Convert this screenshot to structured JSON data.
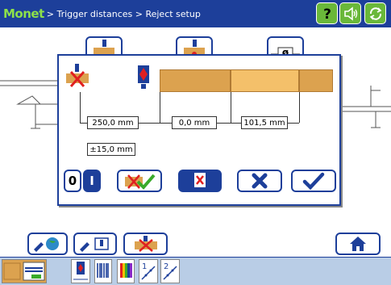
{
  "title": {
    "brand": "Monet",
    "breadcrumb": "> Trigger distances > Reject setup"
  },
  "header_icons": [
    "help-icon",
    "sound-icon",
    "refresh-icon"
  ],
  "dialog": {
    "dist_left": "250,0 mm",
    "dist_mid": "0,0 mm",
    "dist_right": "101,5 mm",
    "tolerance": "±15,0 mm",
    "toggle_zero": "0",
    "toggle_one": "I"
  },
  "colors": {
    "titlebar": "#1d3f9a",
    "accent_green": "#6ab83a",
    "board": "#dca24f",
    "board_highlight": "#f4c06a",
    "toolbar": "#b9cde6"
  }
}
